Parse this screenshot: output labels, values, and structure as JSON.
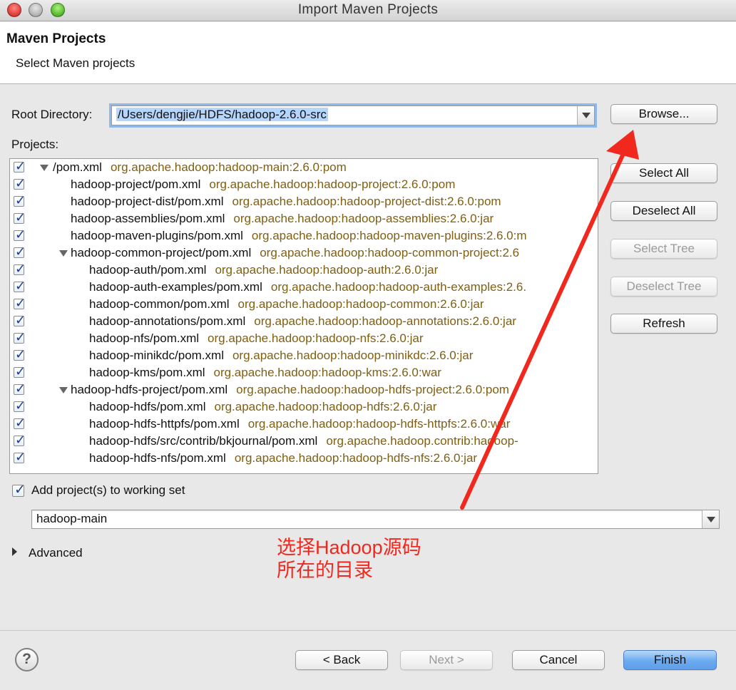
{
  "window": {
    "title": "Import Maven Projects"
  },
  "header": {
    "title": "Maven Projects",
    "subtitle": "Select Maven projects"
  },
  "root": {
    "label": "Root Directory:",
    "value": "/Users/dengjie/HDFS/hadoop-2.6.0-src",
    "browse": "Browse..."
  },
  "projects_label": "Projects:",
  "actions": {
    "select_all": "Select All",
    "deselect_all": "Deselect All",
    "select_tree": "Select Tree",
    "deselect_tree": "Deselect Tree",
    "refresh": "Refresh"
  },
  "tree": [
    {
      "name": "/pom.xml",
      "coord": "org.apache.hadoop:hadoop-main:2.6.0:pom",
      "expanded": true,
      "checked": true
    },
    {
      "name": "hadoop-project/pom.xml",
      "coord": "org.apache.hadoop:hadoop-project:2.6.0:pom",
      "checked": true
    },
    {
      "name": "hadoop-project-dist/pom.xml",
      "coord": "org.apache.hadoop:hadoop-project-dist:2.6.0:pom",
      "checked": true
    },
    {
      "name": "hadoop-assemblies/pom.xml",
      "coord": "org.apache.hadoop:hadoop-assemblies:2.6.0:jar",
      "checked": true
    },
    {
      "name": "hadoop-maven-plugins/pom.xml",
      "coord": "org.apache.hadoop:hadoop-maven-plugins:2.6.0:m",
      "checked": true
    },
    {
      "name": "hadoop-common-project/pom.xml",
      "coord": "org.apache.hadoop:hadoop-common-project:2.6",
      "expanded": true,
      "checked": true
    },
    {
      "name": "hadoop-auth/pom.xml",
      "coord": "org.apache.hadoop:hadoop-auth:2.6.0:jar",
      "checked": true
    },
    {
      "name": "hadoop-auth-examples/pom.xml",
      "coord": "org.apache.hadoop:hadoop-auth-examples:2.6.",
      "checked": true
    },
    {
      "name": "hadoop-common/pom.xml",
      "coord": "org.apache.hadoop:hadoop-common:2.6.0:jar",
      "checked": true
    },
    {
      "name": "hadoop-annotations/pom.xml",
      "coord": "org.apache.hadoop:hadoop-annotations:2.6.0:jar",
      "checked": true
    },
    {
      "name": "hadoop-nfs/pom.xml",
      "coord": "org.apache.hadoop:hadoop-nfs:2.6.0:jar",
      "checked": true
    },
    {
      "name": "hadoop-minikdc/pom.xml",
      "coord": "org.apache.hadoop:hadoop-minikdc:2.6.0:jar",
      "checked": true
    },
    {
      "name": "hadoop-kms/pom.xml",
      "coord": "org.apache.hadoop:hadoop-kms:2.6.0:war",
      "checked": true
    },
    {
      "name": "hadoop-hdfs-project/pom.xml",
      "coord": "org.apache.hadoop:hadoop-hdfs-project:2.6.0:pom",
      "expanded": true,
      "checked": true
    },
    {
      "name": "hadoop-hdfs/pom.xml",
      "coord": "org.apache.hadoop:hadoop-hdfs:2.6.0:jar",
      "checked": true
    },
    {
      "name": "hadoop-hdfs-httpfs/pom.xml",
      "coord": "org.apache.hadoop:hadoop-hdfs-httpfs:2.6.0:war",
      "checked": true
    },
    {
      "name": "hadoop-hdfs/src/contrib/bkjournal/pom.xml",
      "coord": "org.apache.hadoop.contrib:hadoop-",
      "checked": true
    },
    {
      "name": "hadoop-hdfs-nfs/pom.xml",
      "coord": "org.apache.hadoop:hadoop-hdfs-nfs:2.6.0:jar",
      "checked": true
    }
  ],
  "working_set": {
    "checkbox_label": "Add project(s) to working set",
    "checked": true,
    "value": "hadoop-main"
  },
  "advanced": "Advanced",
  "annotation": {
    "line1": "选择Hadoop源码",
    "line2": "所在的目录",
    "color": "#f0281e"
  },
  "footer": {
    "back": "< Back",
    "next": "Next >",
    "cancel": "Cancel",
    "finish": "Finish"
  }
}
